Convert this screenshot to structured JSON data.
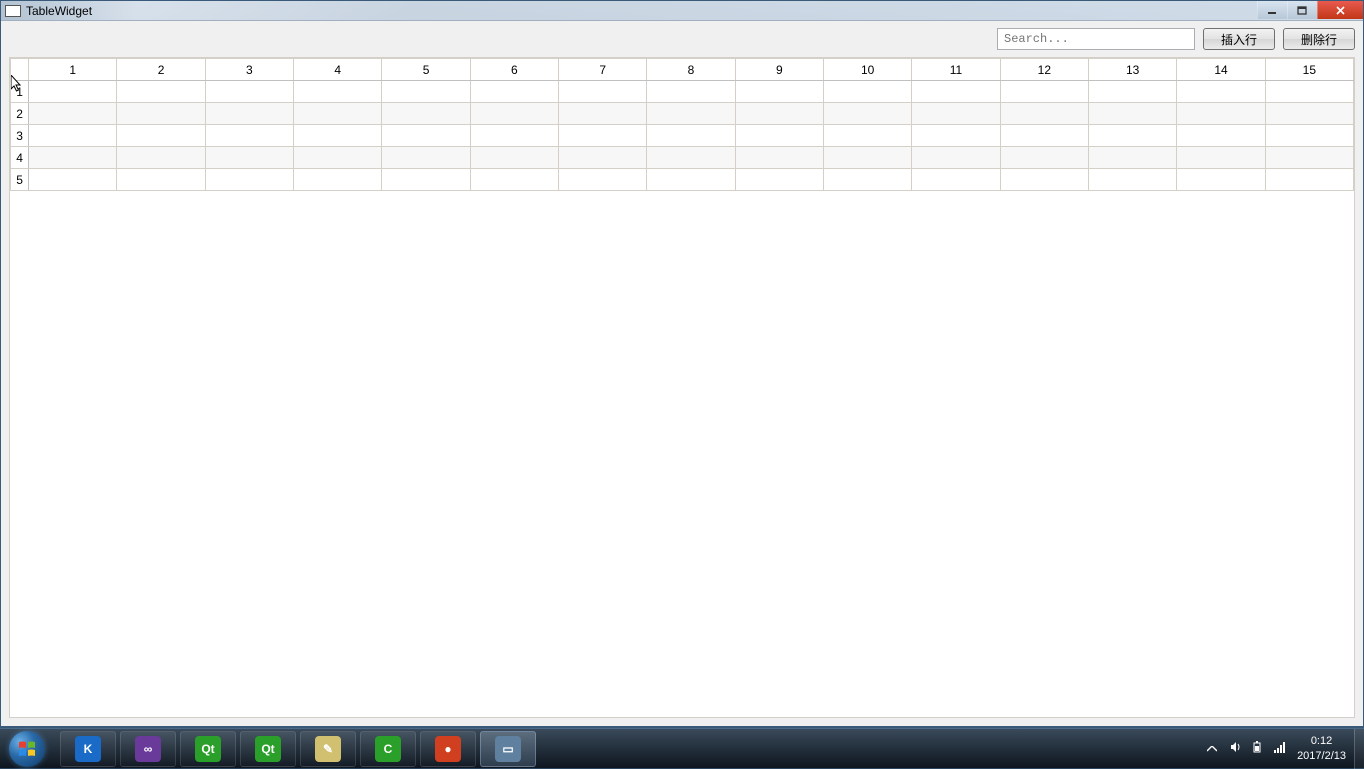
{
  "window": {
    "title": "TableWidget"
  },
  "toolbar": {
    "search_placeholder": "Search...",
    "insert_row_label": "插入行",
    "delete_row_label": "删除行"
  },
  "table": {
    "columns": [
      "1",
      "2",
      "3",
      "4",
      "5",
      "6",
      "7",
      "8",
      "9",
      "10",
      "11",
      "12",
      "13",
      "14",
      "15"
    ],
    "rows": [
      "1",
      "2",
      "3",
      "4",
      "5"
    ],
    "cells": [
      [
        "",
        "",
        "",
        "",
        "",
        "",
        "",
        "",
        "",
        "",
        "",
        "",
        "",
        "",
        ""
      ],
      [
        "",
        "",
        "",
        "",
        "",
        "",
        "",
        "",
        "",
        "",
        "",
        "",
        "",
        "",
        ""
      ],
      [
        "",
        "",
        "",
        "",
        "",
        "",
        "",
        "",
        "",
        "",
        "",
        "",
        "",
        "",
        ""
      ],
      [
        "",
        "",
        "",
        "",
        "",
        "",
        "",
        "",
        "",
        "",
        "",
        "",
        "",
        "",
        ""
      ],
      [
        "",
        "",
        "",
        "",
        "",
        "",
        "",
        "",
        "",
        "",
        "",
        "",
        "",
        "",
        ""
      ]
    ]
  },
  "taskbar": {
    "items": [
      {
        "name": "kugou",
        "color": "#1a6ac8",
        "letter": "K"
      },
      {
        "name": "visual-studio",
        "color": "#6a3a9a",
        "letter": "∞"
      },
      {
        "name": "qt-creator-1",
        "color": "#2aa02a",
        "letter": "Qt"
      },
      {
        "name": "qt-creator-2",
        "color": "#2aa02a",
        "letter": "Qt"
      },
      {
        "name": "notepad",
        "color": "#d0c070",
        "letter": "✎"
      },
      {
        "name": "camtasia",
        "color": "#2aa02a",
        "letter": "C"
      },
      {
        "name": "recorder",
        "color": "#d04020",
        "letter": "●"
      },
      {
        "name": "tablewidget",
        "color": "#6080a0",
        "letter": "▭",
        "active": true
      }
    ]
  },
  "tray": {
    "time": "0:12",
    "date": "2017/2/13"
  }
}
